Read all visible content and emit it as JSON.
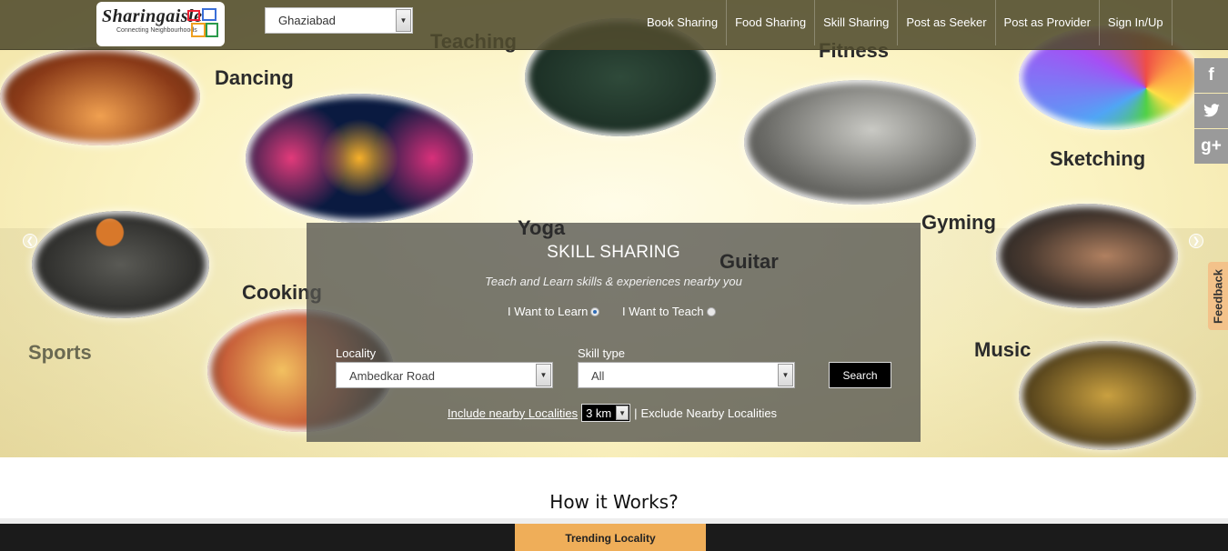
{
  "header": {
    "logo_text": "Sharingaisle",
    "logo_tagline": "Connecting Neighbourhoods",
    "city": "Ghaziabad",
    "nav": [
      "Book Sharing",
      "Food Sharing",
      "Skill Sharing",
      "Post as Seeker",
      "Post as Provider",
      "Sign In/Up"
    ]
  },
  "hero": {
    "labels": {
      "teaching": "Teaching",
      "dancing": "Dancing",
      "fitness": "Fitness",
      "sketching": "Sketching",
      "yoga": "Yoga",
      "gyming": "Gyming",
      "guitar": "Guitar",
      "cooking": "Cooking",
      "sports": "Sports",
      "music": "Music"
    }
  },
  "social": {
    "facebook": "f",
    "twitter": "t",
    "google_plus": "g+"
  },
  "feedback_label": "Feedback",
  "search_panel": {
    "title": "SKILL SHARING",
    "subtitle": "Teach and Learn skills & experiences nearby you",
    "options": {
      "learn": "I Want to Learn",
      "teach": "I Want to Teach"
    },
    "selected_option": "learn",
    "locality_label": "Locality",
    "locality_value": "Ambedkar Road",
    "skill_type_label": "Skill type",
    "skill_type_value": "All",
    "search_label": "Search",
    "include_nearby": "Include nearby Localities",
    "radius": "3 km",
    "separator": "|",
    "exclude_nearby": "Exclude Nearby Localities"
  },
  "sections": {
    "how_it_works": "How it Works?",
    "trending": "Trending Locality"
  },
  "colors": {
    "nav_bg": "#504b2d",
    "panel_bg": "#555550",
    "trending_bg": "#efae59",
    "feedback_bg": "#f3c28a"
  }
}
